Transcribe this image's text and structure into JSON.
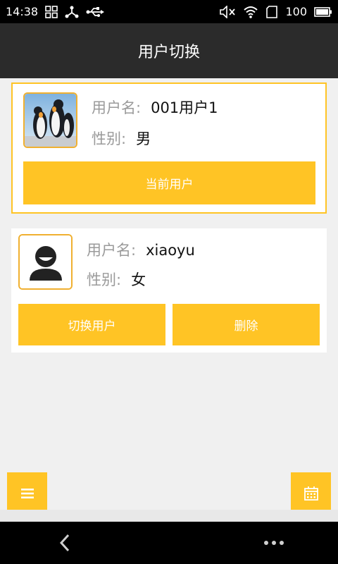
{
  "status_bar": {
    "time": "14:38",
    "battery": "100",
    "left_icons": [
      "grid-icon",
      "share-nodes-icon",
      "usb-icon"
    ],
    "right_icons": [
      "mute-icon",
      "wifi-icon",
      "sim-card-icon",
      "battery-icon"
    ]
  },
  "header": {
    "title": "用户切换"
  },
  "users": [
    {
      "username_label": "用户名:",
      "username": "001用户1",
      "gender_label": "性别:",
      "gender": "男",
      "avatar": "penguins-photo",
      "button_label": "当前用户"
    },
    {
      "username_label": "用户名:",
      "username": "xiaoyu",
      "gender_label": "性别:",
      "gender": "女",
      "avatar": "default-avatar-icon",
      "switch_label": "切换用户",
      "delete_label": "删除"
    }
  ],
  "floating_buttons": [
    "menu-icon",
    "calendar-icon"
  ],
  "nav_bar": [
    "back-icon",
    "more-icon"
  ],
  "colors": {
    "accent": "#ffc425",
    "header": "#2b2b2b",
    "background": "#f0f0f0"
  }
}
